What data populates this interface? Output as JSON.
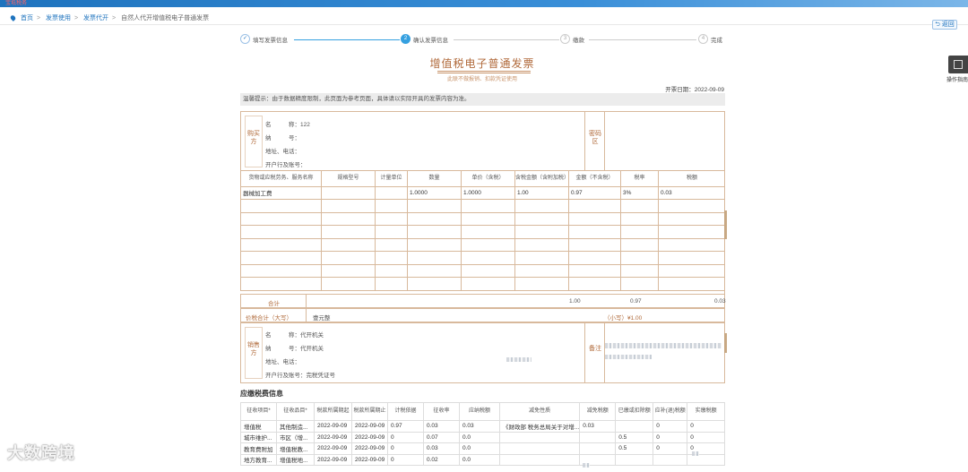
{
  "topbar": {
    "logo": "宝坻税务"
  },
  "breadcrumb": [
    "首页",
    "发票使用",
    "发票代开",
    "自然人代开增值税电子普通发票"
  ],
  "back_label": "返回",
  "guide_label": "操作指南",
  "steps": [
    {
      "num": "✓",
      "label": "填写发票信息",
      "state": "done"
    },
    {
      "num": "2",
      "label": "确认发票信息",
      "state": "active"
    },
    {
      "num": "3",
      "label": "缴款",
      "state": "todo"
    },
    {
      "num": "4",
      "label": "完成",
      "state": "todo"
    }
  ],
  "invoice": {
    "title": "增值税电子普通发票",
    "subtitle": "此联不做报销、扣款凭证使用",
    "date": "开票日期：2022-09-09",
    "warning": "温馨提示：由于数据精度限制，此页面为参考页面，具体请以实际开具的发票内容为准。",
    "buyer_label": "购买方",
    "buyer_name": "名　　　称：122",
    "buyer_tax": "纳　　　号：",
    "buyer_addr": "地址、电话：",
    "buyer_bank": "开户行及账号：",
    "code_area_label": "密码区",
    "columns": [
      "货物或应税劳务、服务名称",
      "规格型号",
      "计量单位",
      "数量",
      "单价（含税）",
      "含税金额（含附加税）",
      "金额（不含税）",
      "税率",
      "税额"
    ],
    "rows": [
      [
        "器械加工费",
        "",
        "",
        "1.0000",
        "1.0000",
        "1.00",
        "0.97",
        "3%",
        "0.03"
      ]
    ],
    "total_label": "合计",
    "total_amount": "1.00",
    "total_net": "0.97",
    "total_tax": "0.03",
    "grand_label": "价税合计（大写）",
    "grand_caps": "壹元整",
    "grand_small": "（小写）¥1.00",
    "seller_label": "销售方",
    "seller_name": "名　　　称：代开机关",
    "seller_tax": "纳　　　号：代开机关",
    "seller_addr": "地址、电话：",
    "seller_bank": "开户行及账号：完税凭证号",
    "remark_label": "备注"
  },
  "tax": {
    "title": "应缴税费信息",
    "columns": [
      "征收项目*",
      "征收品目*",
      "税款所属期起",
      "税款所属期止",
      "计税依据",
      "征收率",
      "应纳税额",
      "减免性质",
      "减免税额",
      "已缴或扣除额",
      "应补(退)税额",
      "实缴税额"
    ],
    "rows": [
      [
        "增值税",
        "其他制造...",
        "2022-09-09",
        "2022-09-09",
        "0.97",
        "0.03",
        "0.03",
        "《财政部 税务总局关于对增...",
        "0.03",
        "",
        "0",
        "0"
      ],
      [
        "城市维护...",
        "市区（增...",
        "2022-09-09",
        "2022-09-09",
        "0",
        "0.07",
        "0.0",
        "",
        "",
        "0.5",
        "0",
        "0"
      ],
      [
        "教育费附加",
        "增值税教...",
        "2022-09-09",
        "2022-09-09",
        "0",
        "0.03",
        "0.0",
        "",
        "",
        "0.5",
        "0",
        "0"
      ],
      [
        "地方教育...",
        "增值税地...",
        "2022-09-09",
        "2022-09-09",
        "0",
        "0.02",
        "0.0",
        "",
        "",
        "",
        "",
        ""
      ]
    ]
  },
  "watermark": "大数跨境"
}
